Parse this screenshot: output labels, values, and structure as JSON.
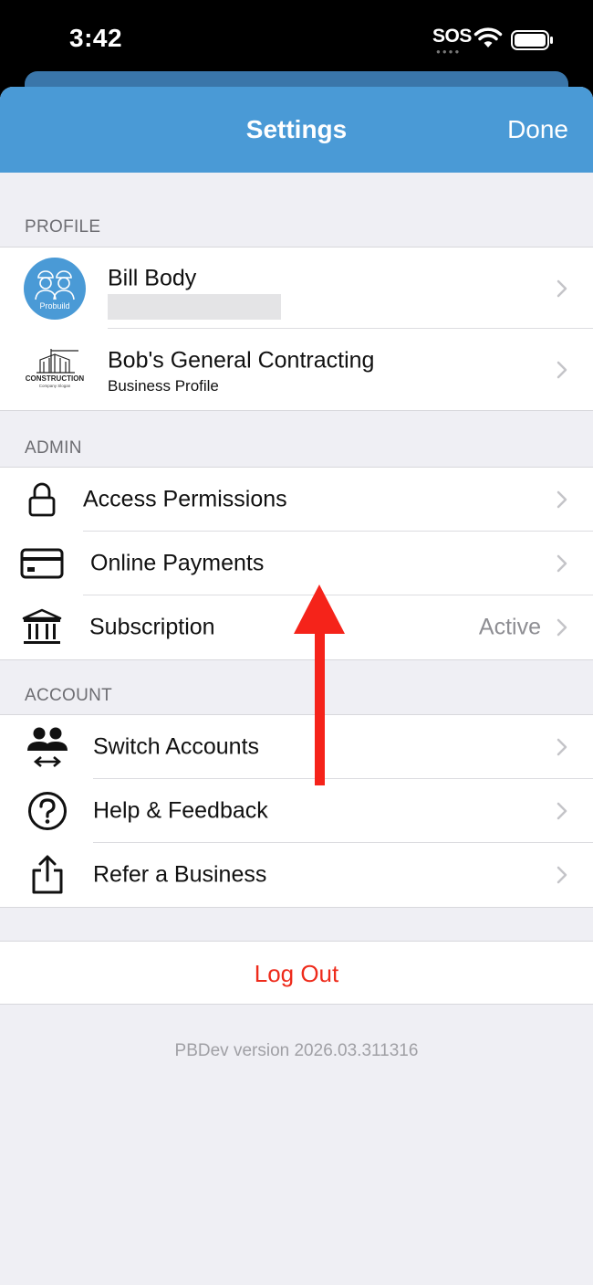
{
  "status_bar": {
    "time": "3:42",
    "carrier": "SOS"
  },
  "nav": {
    "title": "Settings",
    "done_label": "Done"
  },
  "profile": {
    "header": "PROFILE",
    "user_name": "Bill Body",
    "avatar_text": "Probuild",
    "business_name": "Bob's General Contracting",
    "business_subtitle": "Business Profile",
    "logo_text": "CONSTRUCTION",
    "logo_subtext": "Company Slogan"
  },
  "admin": {
    "header": "ADMIN",
    "items": [
      {
        "label": "Access Permissions",
        "icon": "lock-icon"
      },
      {
        "label": "Online Payments",
        "icon": "credit-card-icon"
      },
      {
        "label": "Subscription",
        "icon": "bank-icon",
        "value": "Active"
      }
    ]
  },
  "account": {
    "header": "ACCOUNT",
    "items": [
      {
        "label": "Switch Accounts",
        "icon": "switch-users-icon"
      },
      {
        "label": "Help & Feedback",
        "icon": "help-icon"
      },
      {
        "label": "Refer a Business",
        "icon": "share-icon"
      }
    ]
  },
  "logout_label": "Log Out",
  "version_text": "PBDev version 2026.03.311316",
  "colors": {
    "nav": "#4a9ad6",
    "logout": "#ee2b1b",
    "arrow": "#f5231a"
  }
}
